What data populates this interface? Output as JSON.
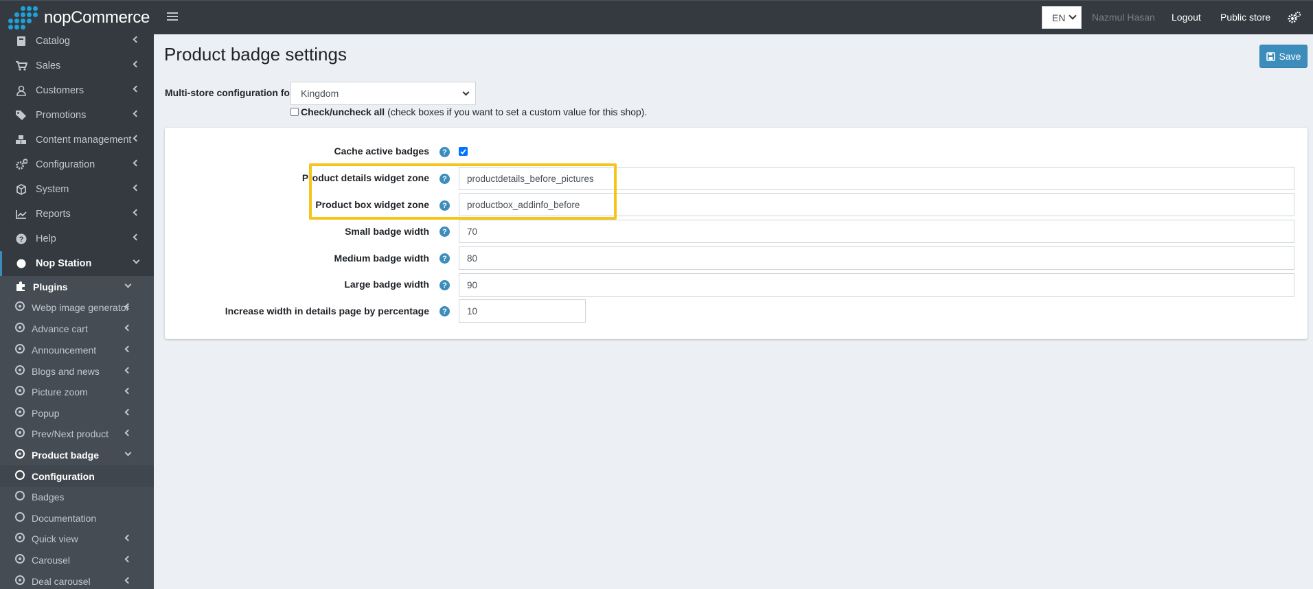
{
  "header": {
    "logo_text": "nopCommerce",
    "language": "EN",
    "user_name": "Nazmul Hasan",
    "logout": "Logout",
    "public_store": "Public store"
  },
  "sidebar": {
    "items": [
      {
        "label": "Catalog",
        "icon": "book-icon"
      },
      {
        "label": "Sales",
        "icon": "cart-icon"
      },
      {
        "label": "Customers",
        "icon": "user-icon"
      },
      {
        "label": "Promotions",
        "icon": "tags-icon"
      },
      {
        "label": "Content management",
        "icon": "cubes-icon"
      },
      {
        "label": "Configuration",
        "icon": "cogs-icon"
      },
      {
        "label": "System",
        "icon": "cube-icon"
      },
      {
        "label": "Reports",
        "icon": "chart-icon"
      },
      {
        "label": "Help",
        "icon": "question-icon"
      },
      {
        "label": "Nop Station",
        "icon": "circle-icon"
      }
    ],
    "plugins_label": "Plugins",
    "plugins": [
      "Webp image generator",
      "Advance cart",
      "Announcement",
      "Blogs and news",
      "Picture zoom",
      "Popup",
      "Prev/Next product",
      "Product badge"
    ],
    "product_badge_sub": [
      "Configuration",
      "Badges",
      "Documentation"
    ],
    "plugins_after": [
      "Quick view",
      "Carousel",
      "Deal carousel"
    ]
  },
  "main": {
    "title": "Product badge settings",
    "save_label": "Save",
    "multistore_label": "Multi-store configuration for",
    "multistore_value": "Kingdom",
    "check_all_bold": "Check/uncheck all",
    "check_all_note": "(check boxes if you want to set a custom value for this shop).",
    "fields": [
      {
        "label": "Cache active badges",
        "value": ""
      },
      {
        "label": "Product details widget zone",
        "value": "productdetails_before_pictures"
      },
      {
        "label": "Product box widget zone",
        "value": "productbox_addinfo_before"
      },
      {
        "label": "Small badge width",
        "value": "70"
      },
      {
        "label": "Medium badge width",
        "value": "80"
      },
      {
        "label": "Large badge width",
        "value": "90"
      },
      {
        "label": "Increase width in details page by percentage",
        "value": "10"
      }
    ],
    "help_glyph": "?"
  },
  "colors": {
    "accent": "#3c8dbc",
    "highlight": "#f5c518",
    "sidebar_bg": "#343a40"
  }
}
